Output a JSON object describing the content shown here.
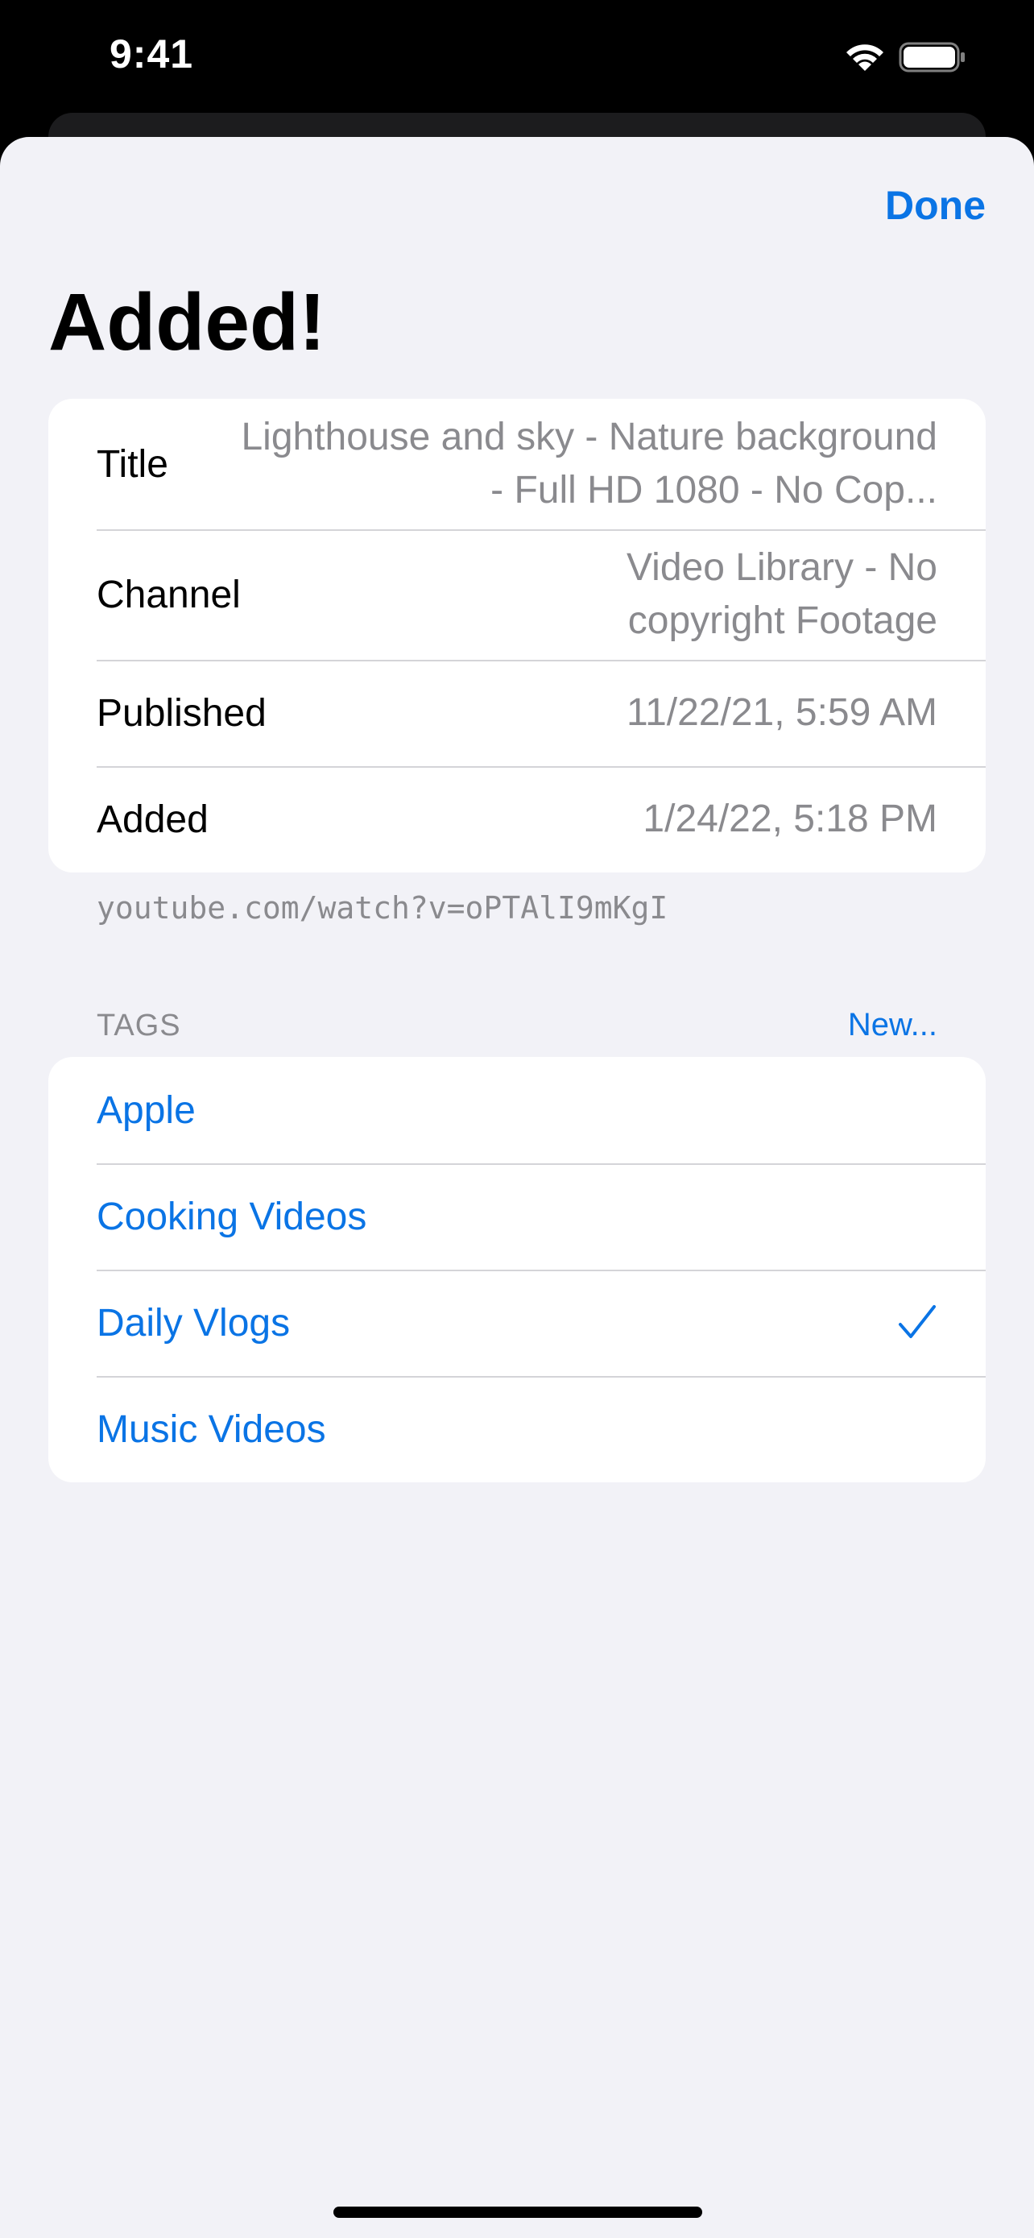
{
  "status_bar": {
    "time": "9:41",
    "wifi_icon": "wifi-icon",
    "battery_icon": "battery-icon"
  },
  "navigation": {
    "done_label": "Done"
  },
  "page": {
    "title": "Added!"
  },
  "info": {
    "title_label": "Title",
    "title_value": "Lighthouse and sky -  Nature background - Full HD 1080 - No Cop...",
    "channel_label": "Channel",
    "channel_value": "Video Library - No copyright Footage",
    "published_label": "Published",
    "published_value": "11/22/21, 5:59 AM",
    "added_label": "Added",
    "added_value": "1/24/22, 5:18 PM"
  },
  "url": "youtube.com/watch?v=oPTAlI9mKgI",
  "tags": {
    "header": "TAGS",
    "new_label": "New...",
    "items": [
      {
        "label": "Apple",
        "selected": false
      },
      {
        "label": "Cooking Videos",
        "selected": false
      },
      {
        "label": "Daily Vlogs",
        "selected": true
      },
      {
        "label": "Music Videos",
        "selected": false
      }
    ]
  },
  "colors": {
    "accent": "#0a74e5",
    "background": "#f2f2f7",
    "secondary_text": "#8a8a8e"
  }
}
